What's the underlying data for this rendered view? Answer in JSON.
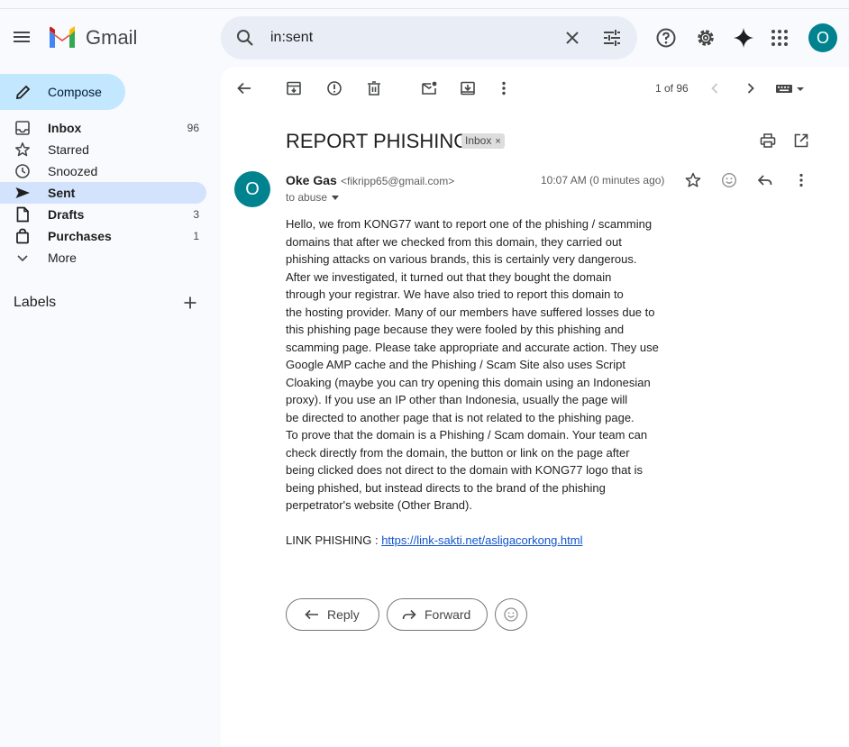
{
  "app": {
    "name": "Gmail"
  },
  "search": {
    "value": "in:sent"
  },
  "user": {
    "initial": "O"
  },
  "sidebar": {
    "compose_label": "Compose",
    "items": [
      {
        "label": "Inbox",
        "count": "96",
        "icon": "inbox-icon",
        "bold": true
      },
      {
        "label": "Starred",
        "count": "",
        "icon": "star-icon",
        "bold": false
      },
      {
        "label": "Snoozed",
        "count": "",
        "icon": "clock-icon",
        "bold": false
      },
      {
        "label": "Sent",
        "count": "",
        "icon": "send-icon",
        "bold": true,
        "active": true
      },
      {
        "label": "Drafts",
        "count": "3",
        "icon": "draft-icon",
        "bold": true
      },
      {
        "label": "Purchases",
        "count": "1",
        "icon": "bag-icon",
        "bold": true
      },
      {
        "label": "More",
        "count": "",
        "icon": "chevron-down-icon",
        "bold": false
      }
    ],
    "labels_title": "Labels"
  },
  "toolbar": {
    "pager": "1 of 96"
  },
  "message": {
    "subject": "REPORT PHISHING",
    "label_chip": "Inbox",
    "chip_close": "×",
    "sender_name": "Oke Gas",
    "sender_email": "<fikripp65@gmail.com>",
    "to": "to abuse",
    "time": "10:07 AM (0 minutes ago)",
    "sender_initial": "O",
    "body_lines": [
      "Hello, we from KONG77 want to report one of the phishing / scamming",
      "domains that after we checked from this domain, they carried out",
      "phishing attacks on various brands, this is certainly very dangerous.",
      "After we investigated, it turned out that they bought the domain",
      "through your registrar. We have also tried to report this domain to",
      "the hosting provider. Many of our members have suffered losses due to",
      "this phishing page because they were fooled by this phishing and",
      "scamming page. Please take appropriate and accurate action. They use",
      "Google AMP cache and the Phishing / Scam Site also uses Script",
      "Cloaking (maybe you can try opening this domain using an Indonesian",
      "proxy). If you use an IP other than Indonesia, usually the page will",
      "be directed to another page that is not related to the phishing page.",
      "To prove that the domain is a Phishing / Scam domain. Your team can",
      "check directly from the domain, the button or link on the page after",
      "being clicked does not direct to the domain with KONG77 logo that is",
      "being phished, but instead directs to the brand of the phishing",
      "perpetrator's website (Other Brand)."
    ],
    "link_prefix": "LINK PHISHING : ",
    "link_text": "https://link-sakti.net/asligacorkong.html"
  },
  "actions": {
    "reply_label": "Reply",
    "forward_label": "Forward"
  },
  "colors": {
    "compose_bg": "#c2e7ff",
    "active_nav": "#d3e3fd",
    "avatar": "#00838f",
    "link": "#1155cc"
  }
}
